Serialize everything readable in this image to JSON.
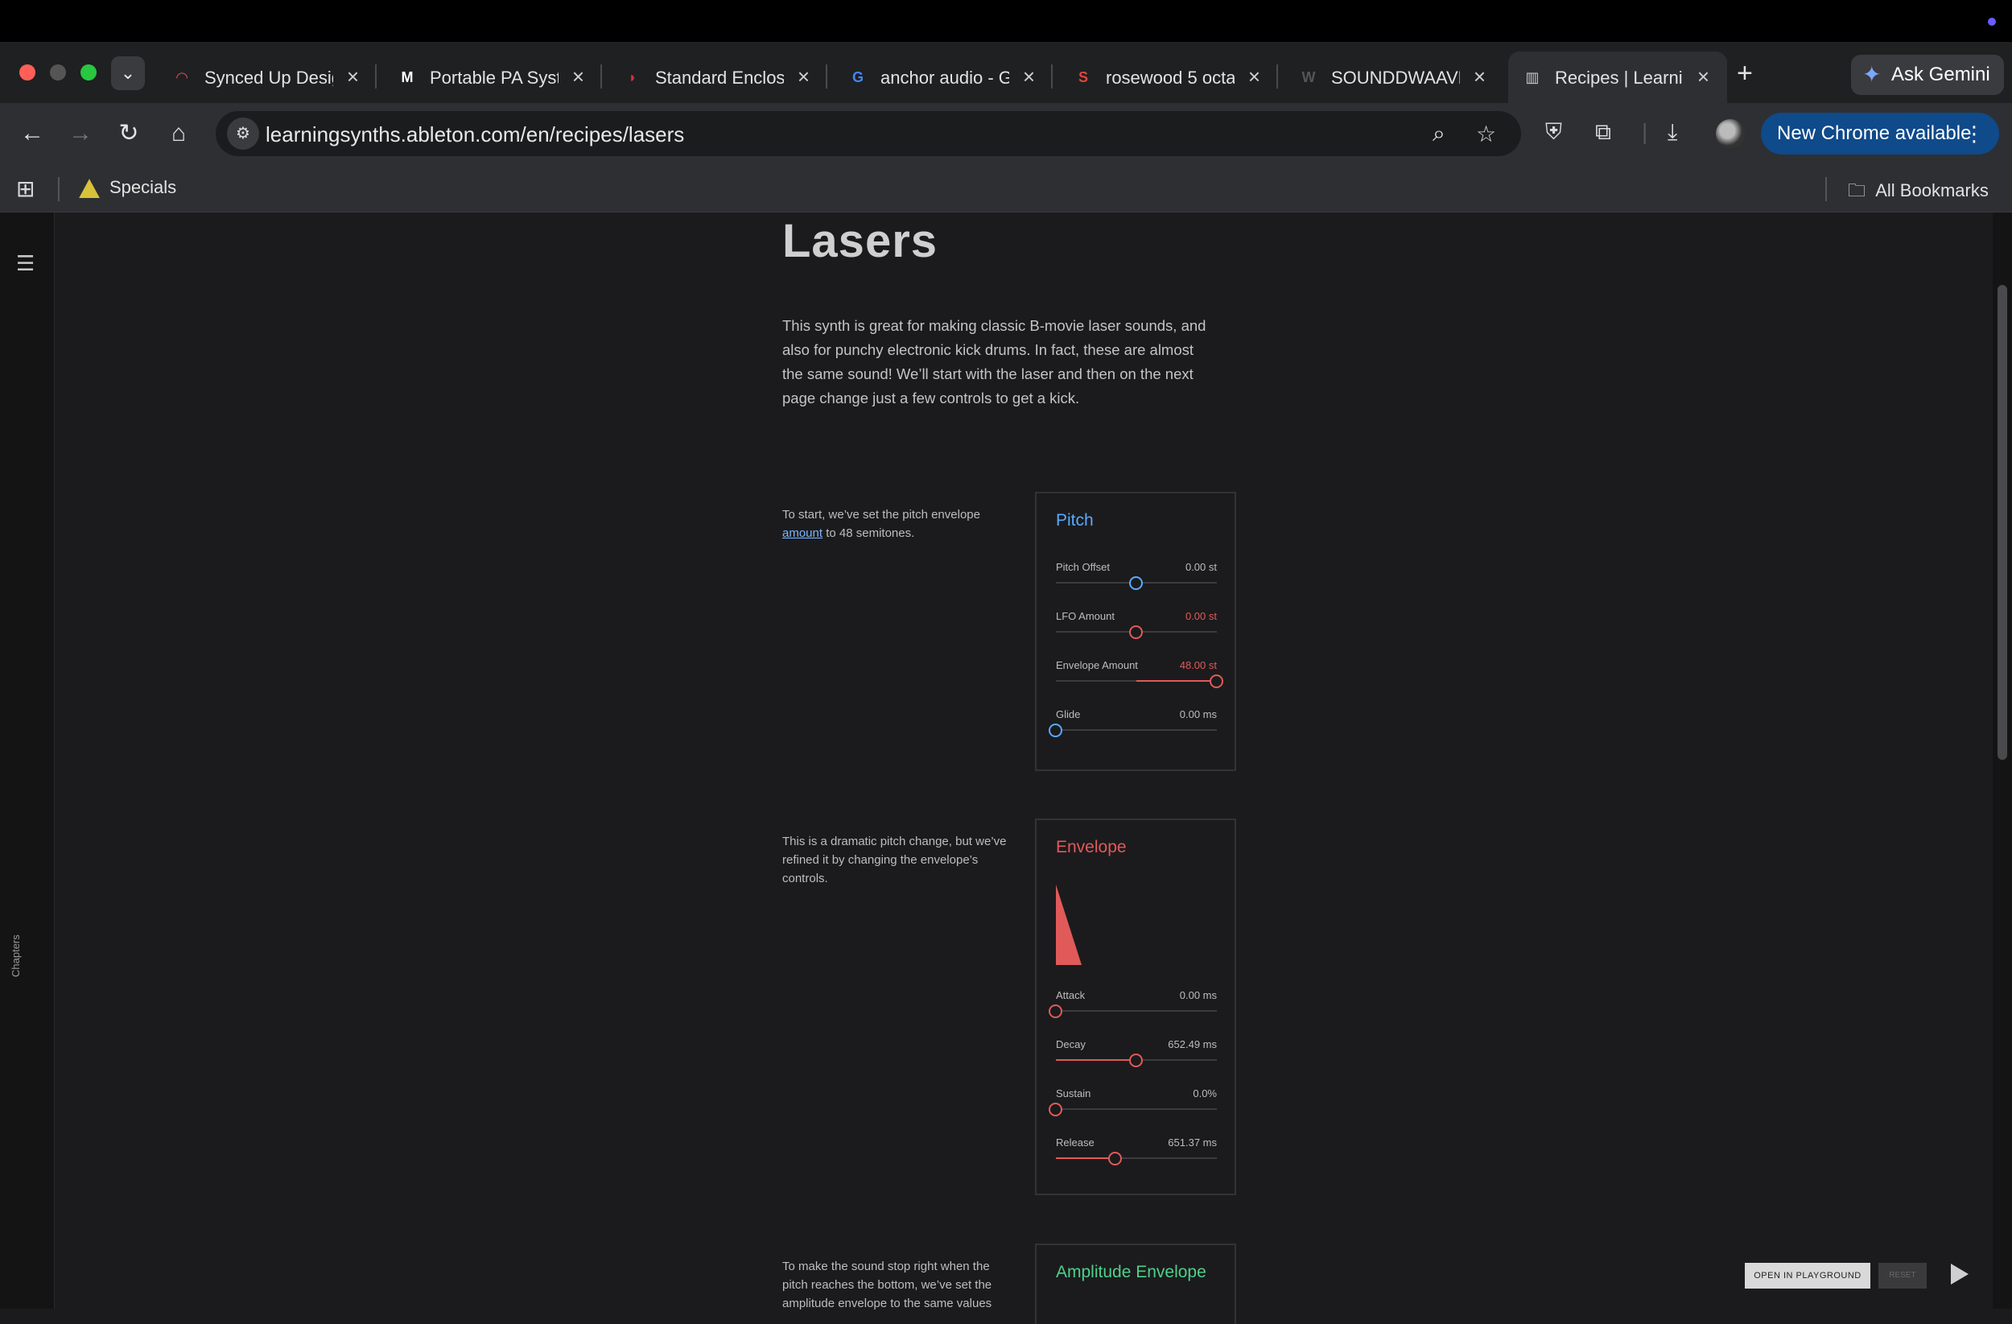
{
  "browser": {
    "tabs": [
      {
        "label": "Synced Up Desig",
        "icon": "synced-up-favicon",
        "color": "#e05050",
        "glyph": "◠"
      },
      {
        "label": "Portable PA Syst",
        "icon": "m-favicon",
        "color": "#ffffff",
        "glyph": "M"
      },
      {
        "label": "Standard Enclos",
        "icon": "enclosure-favicon",
        "color": "#d63030",
        "glyph": "◗"
      },
      {
        "label": "anchor audio - G",
        "icon": "google-favicon",
        "color": "#4285f4",
        "glyph": "G"
      },
      {
        "label": "rosewood 5 octa",
        "icon": "s-favicon",
        "color": "#e0463a",
        "glyph": "S"
      },
      {
        "label": "SOUNDDWAAVE",
        "icon": "w-favicon",
        "color": "#555555",
        "glyph": "W"
      },
      {
        "label": "Recipes | Learnin",
        "icon": "ableton-favicon",
        "color": "#cccccc",
        "glyph": "▥"
      }
    ],
    "new_tab_label": "+",
    "gemini_label": "Ask Gemini",
    "url": "learningsynths.ableton.com/en/recipes/lasers",
    "update_label": "New Chrome available",
    "bookmarks": {
      "specials": "Specials",
      "all": "All Bookmarks"
    }
  },
  "sidebar": {
    "chapters_label": "Chapters"
  },
  "page": {
    "title": "Lasers",
    "intro": "This synth is great for making classic B-movie laser sounds, and also for punchy electronic kick drums. In fact, these are almost the same sound! We’ll start with the laser and then on the next page change just a few controls to get a kick.",
    "note1_pre": "To start, we’ve set the pitch envelope ",
    "note1_link": "amount",
    "note1_post": " to 48 semitones.",
    "note2": "This is a dramatic pitch change, but we’ve refined it by changing the envelope’s controls.",
    "note3": "To make the sound stop right when the pitch reaches the bottom, we’ve set the amplitude envelope to the same values"
  },
  "pitch_panel": {
    "title": "Pitch",
    "accent": "#5aa9ff",
    "params": [
      {
        "name": "Pitch Offset",
        "value": "0.00 st",
        "level": 0.5,
        "color": "#5aa9ff",
        "fill": false,
        "value_color": "#bdbdbd"
      },
      {
        "name": "LFO Amount",
        "value": "0.00 st",
        "level": 0.5,
        "color": "#e05a5a",
        "fill": false,
        "value_color": "#e05a5a"
      },
      {
        "name": "Envelope Amount",
        "value": "48.00 st",
        "level": 1.0,
        "color": "#e05a5a",
        "fill": true,
        "value_color": "#e05a5a"
      },
      {
        "name": "Glide",
        "value": "0.00 ms",
        "level": 0.0,
        "color": "#5aa9ff",
        "fill": false,
        "value_color": "#bdbdbd"
      }
    ]
  },
  "envelope_panel": {
    "title": "Envelope",
    "accent": "#e05a5a",
    "params": [
      {
        "name": "Attack",
        "value": "0.00 ms",
        "level": 0.0,
        "color": "#e05a5a",
        "fill": false,
        "value_color": "#bdbdbd"
      },
      {
        "name": "Decay",
        "value": "652.49 ms",
        "level": 0.5,
        "color": "#e05a5a",
        "fill": true,
        "value_color": "#bdbdbd"
      },
      {
        "name": "Sustain",
        "value": "0.0%",
        "level": 0.0,
        "color": "#e05a5a",
        "fill": false,
        "value_color": "#bdbdbd"
      },
      {
        "name": "Release",
        "value": "651.37 ms",
        "level": 0.37,
        "color": "#e05a5a",
        "fill": true,
        "value_color": "#bdbdbd"
      }
    ]
  },
  "amp_panel": {
    "title": "Amplitude Envelope",
    "accent": "#4fd08a"
  },
  "controls": {
    "open_playground": "OPEN IN PLAYGROUND",
    "reset": "RESET"
  }
}
